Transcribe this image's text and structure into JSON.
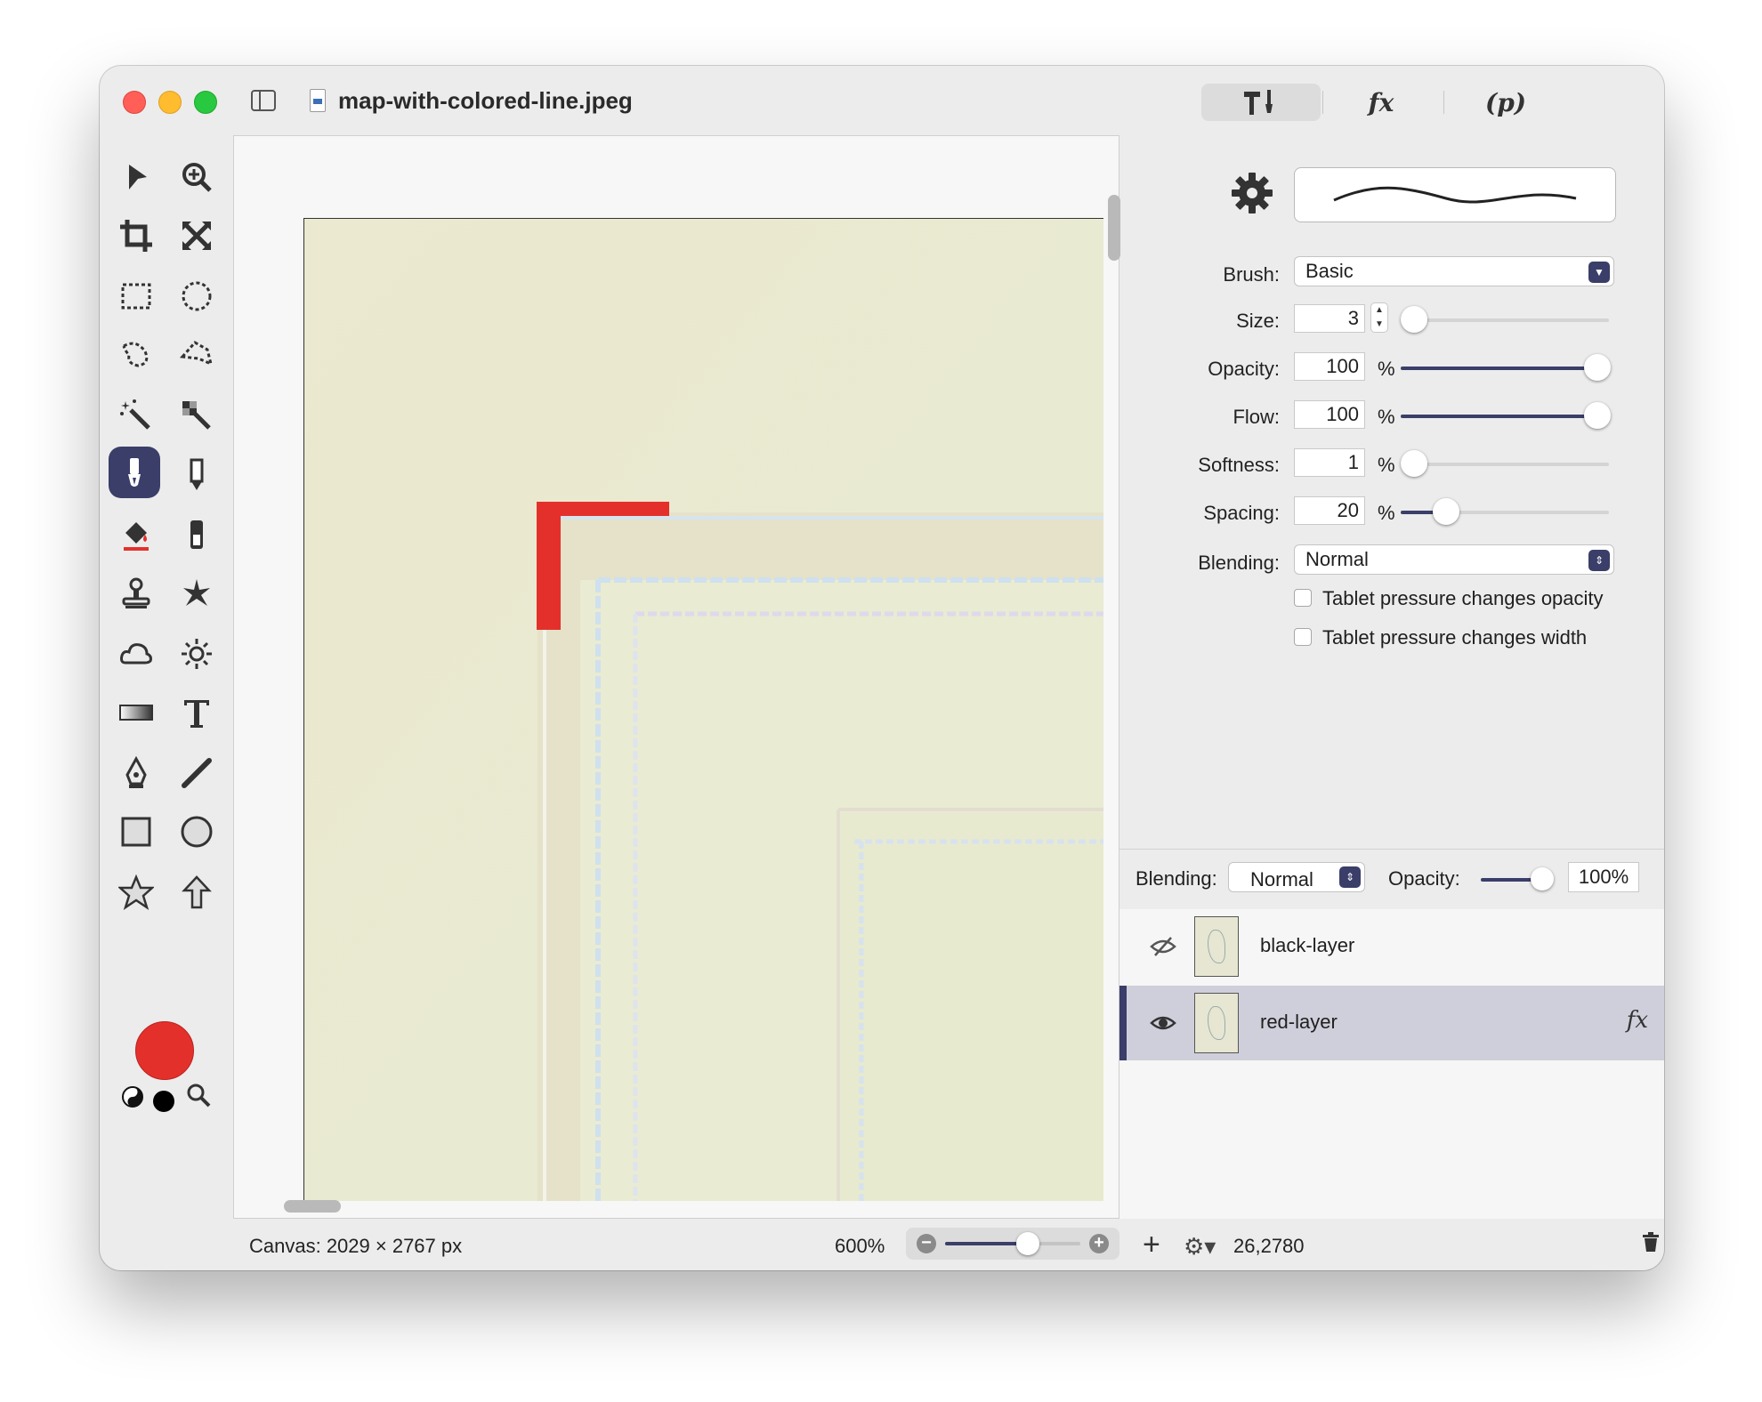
{
  "window": {
    "title": "map-with-colored-line.jpeg",
    "toolbar_tabs": [
      {
        "name": "tools",
        "label": "⚒︎"
      },
      {
        "name": "effects",
        "label": "fx"
      },
      {
        "name": "properties",
        "label": "(p)"
      }
    ]
  },
  "tools": [
    "arrow-tool",
    "zoom-tool",
    "crop-tool",
    "transform-tool",
    "rect-select-tool",
    "ellipse-select-tool",
    "lasso-tool",
    "polygon-lasso-tool",
    "magic-wand-tool",
    "color-select-tool",
    "brush-tool",
    "pencil-tool",
    "paint-bucket-tool",
    "eraser-tool",
    "clone-stamp-tool",
    "retouch-tool",
    "blur-tool",
    "dodge-tool",
    "gradient-tool",
    "text-tool",
    "pen-tool",
    "line-tool",
    "rectangle-shape-tool",
    "ellipse-shape-tool",
    "star-shape-tool",
    "arrow-shape-tool"
  ],
  "active_tool": "brush-tool",
  "colors": {
    "primary": "#e4302b",
    "secondary": "#000000",
    "accent": "#3a3e69",
    "paint_stroke": "#e4302b"
  },
  "brush_settings": {
    "brush_label": "Brush:",
    "brush_value": "Basic",
    "size_label": "Size:",
    "size_value": "3",
    "opacity_label": "Opacity:",
    "opacity_value": "100",
    "flow_label": "Flow:",
    "flow_value": "100",
    "softness_label": "Softness:",
    "softness_value": "1",
    "spacing_label": "Spacing:",
    "spacing_value": "20",
    "percent": "%",
    "blending_label": "Blending:",
    "blending_value": "Normal",
    "tablet_opacity": "Tablet pressure changes opacity",
    "tablet_width": "Tablet pressure changes width"
  },
  "layers_header": {
    "blending_label": "Blending:",
    "blending_value": "Normal",
    "opacity_label": "Opacity:",
    "opacity_value": "100%"
  },
  "layers": [
    {
      "name": "black-layer",
      "visible": false,
      "selected": false
    },
    {
      "name": "red-layer",
      "visible": true,
      "selected": true,
      "fx": "fx"
    }
  ],
  "status": {
    "canvas_info": "Canvas: 2029 × 2767 px",
    "zoom": "600%",
    "coords": "26,2780"
  }
}
